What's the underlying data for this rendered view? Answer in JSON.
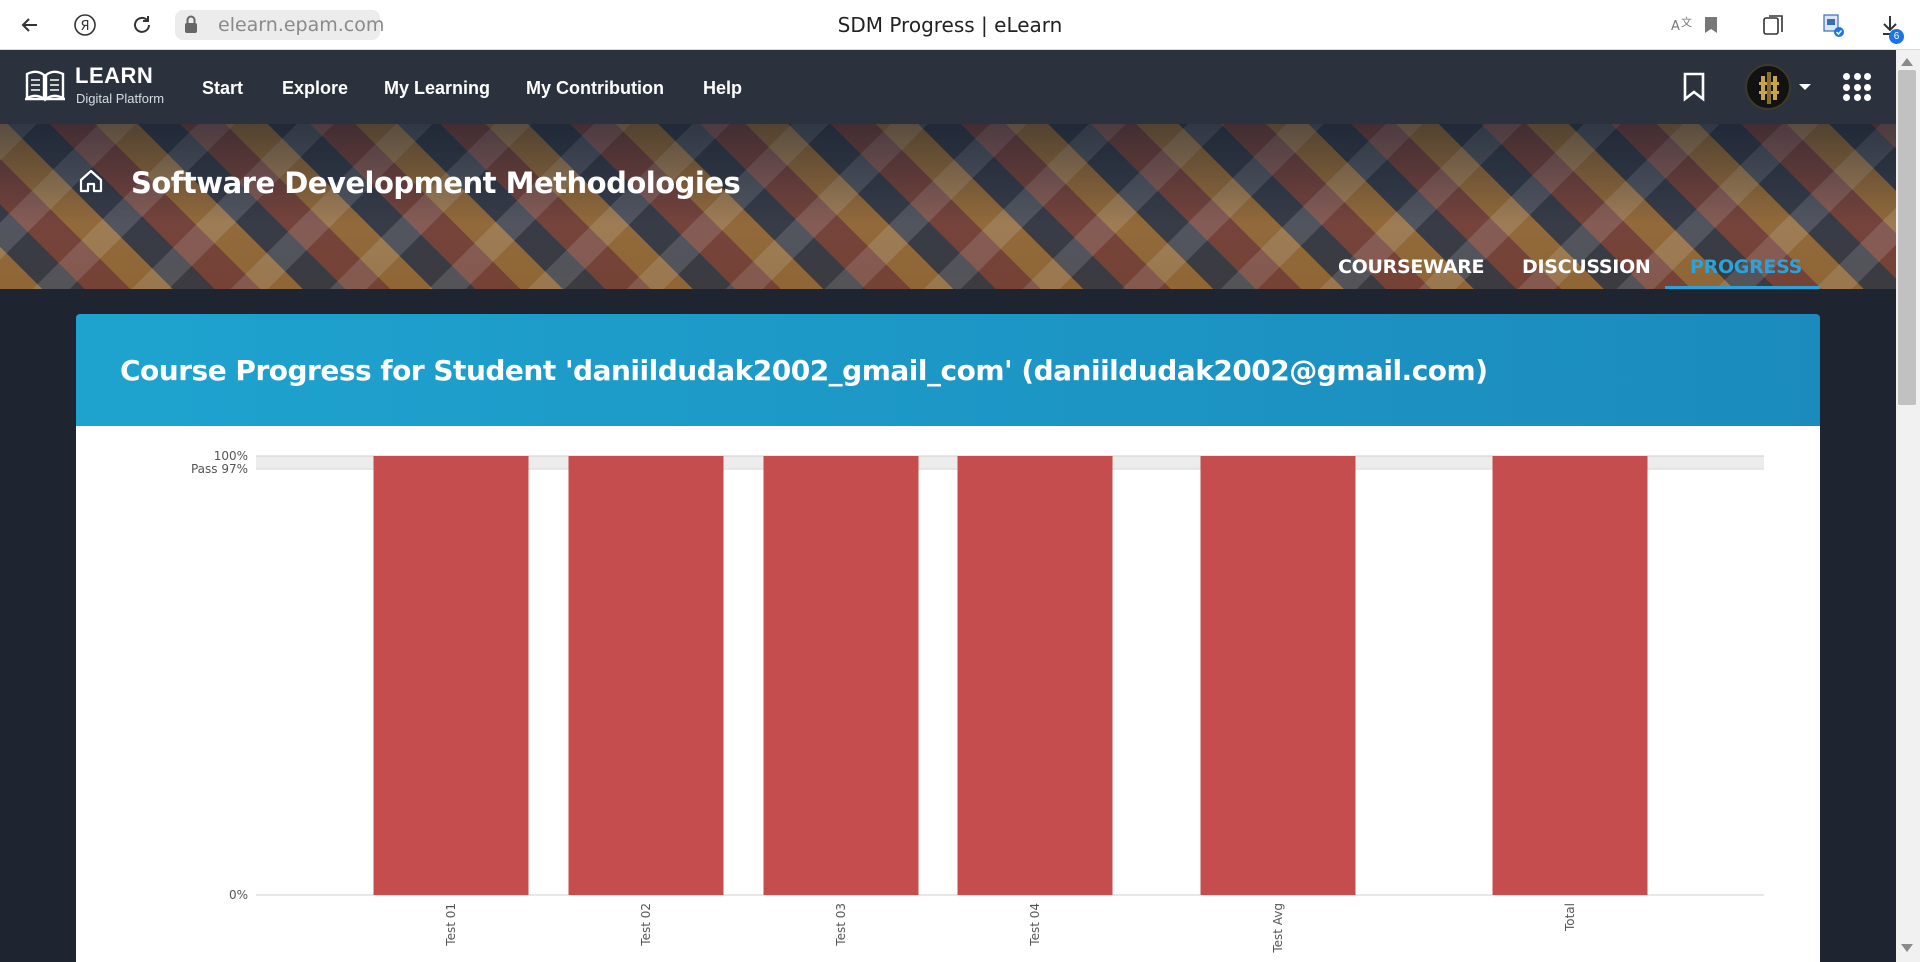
{
  "browser": {
    "url": "elearn.epam.com",
    "tab_title": "SDM Progress | eLearn",
    "downloads_badge": "6"
  },
  "nav": {
    "logo_title": "LEARN",
    "logo_subtitle": "Digital Platform",
    "links": [
      "Start",
      "Explore",
      "My Learning",
      "My Contribution",
      "Help"
    ]
  },
  "course": {
    "title": "Software Development Methodologies",
    "tabs": [
      {
        "label": "COURSEWARE",
        "active": false
      },
      {
        "label": "DISCUSSION",
        "active": false
      },
      {
        "label": "PROGRESS",
        "active": true
      }
    ]
  },
  "progress": {
    "heading": "Course Progress for Student 'daniildudak2002_gmail_com' (daniildudak2002@gmail.com)"
  },
  "colors": {
    "accent": "#29a3d9",
    "bar": "#c64d4d",
    "nav_bg": "#2b313d"
  },
  "chart_data": {
    "type": "bar",
    "categories": [
      "Test 01",
      "Test 02",
      "Test 03",
      "Test 04",
      "Test Avg",
      "Total"
    ],
    "values": [
      100,
      100,
      100,
      100,
      100,
      100
    ],
    "ylim": [
      0,
      100
    ],
    "yticks": [
      {
        "value": 100,
        "label": "100%"
      },
      {
        "value": 97,
        "label": "Pass 97%"
      },
      {
        "value": 0,
        "label": "0%"
      }
    ],
    "pass_threshold": 97,
    "grid": false
  }
}
